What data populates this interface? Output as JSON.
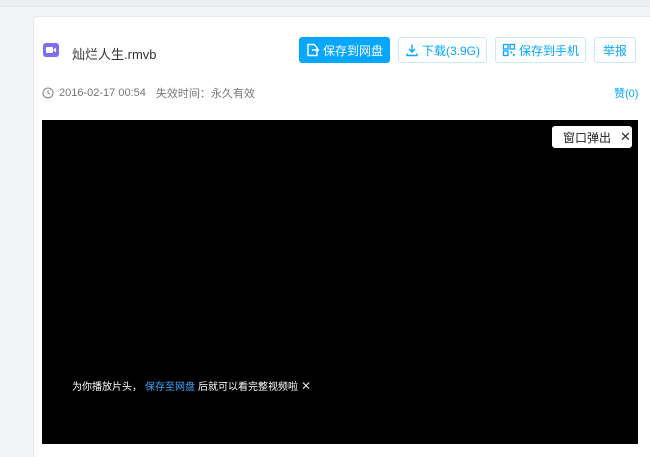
{
  "file": {
    "name": "灿烂人生.rmvb",
    "icon": "video-file-icon",
    "icon_color": "#7b6ff0"
  },
  "toolbar": {
    "save_label": "保存到网盘",
    "download_label": "下载(3.9G)",
    "save_phone_label": "保存到手机",
    "report_label": "举报"
  },
  "meta": {
    "datetime": "2016-02-17 00:54",
    "expire": "失效时间：永久有效",
    "like": "赞(0)"
  },
  "player": {
    "popup_label": "窗口弹出",
    "notice_prefix": "为你播放片头，",
    "notice_link": "保存至网盘",
    "notice_suffix": "后就可以看完整视频啦"
  },
  "colors": {
    "accent": "#06a7ff",
    "video_bg": "#000000"
  }
}
